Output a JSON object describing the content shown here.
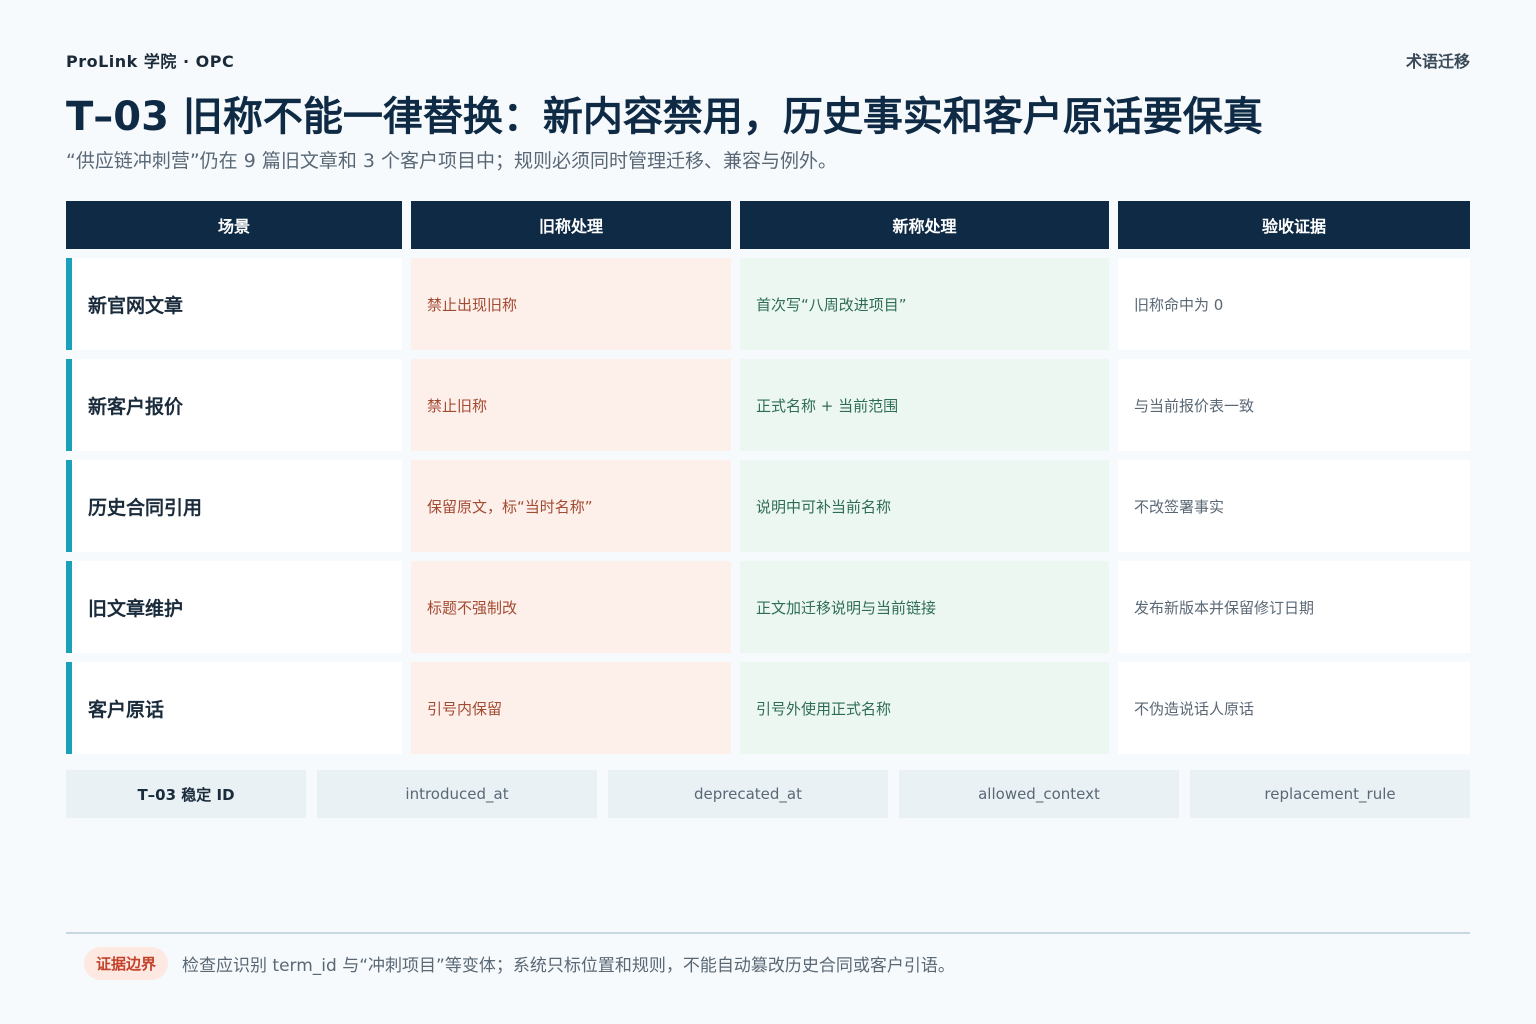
{
  "header": {
    "brand": "ProLink 学院 · OPC",
    "section": "术语迁移",
    "title": "T–03 旧称不能一律替换：新内容禁用，历史事实和客户原话要保真",
    "subtitle": "“供应链冲刺营”仍在 9 篇旧文章和 3 个客户项目中；规则必须同时管理迁移、兼容与例外。"
  },
  "table": {
    "columns": [
      "场景",
      "旧称处理",
      "新称处理",
      "验收证据"
    ],
    "rows": [
      {
        "scene": "新官网文章",
        "old": "禁止出现旧称",
        "new": "首次写“八周改进项目”",
        "evidence": "旧称命中为 0"
      },
      {
        "scene": "新客户报价",
        "old": "禁止旧称",
        "new": "正式名称 + 当前范围",
        "evidence": "与当前报价表一致"
      },
      {
        "scene": "历史合同引用",
        "old": "保留原文，标“当时名称”",
        "new": "说明中可补当前名称",
        "evidence": "不改签署事实"
      },
      {
        "scene": "旧文章维护",
        "old": "标题不强制改",
        "new": "正文加迁移说明与当前链接",
        "evidence": "发布新版本并保留修订日期"
      },
      {
        "scene": "客户原话",
        "old": "引号内保留",
        "new": "引号外使用正式名称",
        "evidence": "不伪造说话人原话"
      }
    ]
  },
  "fields": [
    "T–03 稳定 ID",
    "introduced_at",
    "deprecated_at",
    "allowed_context",
    "replacement_rule"
  ],
  "footer": {
    "badge": "证据边界",
    "note": "检查应识别 term_id 与“冲刺项目”等变体；系统只标位置和规则，不能自动篡改历史合同或客户引语。"
  },
  "colors": {
    "header_bg": "#0f2a44",
    "accent_bar": "#1aa0b8",
    "old_bg": "#fdf0ea",
    "old_text": "#a34a32",
    "new_bg": "#edf7f2",
    "new_text": "#2e6d55",
    "badge_bg": "#fde8e2",
    "badge_text": "#c2432a"
  }
}
